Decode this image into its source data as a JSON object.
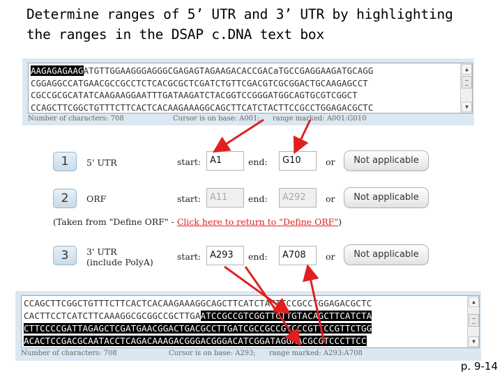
{
  "heading": {
    "line1": "Determine ranges of 5’ UTR and 3’ UTR by highlighting",
    "line2": "the ranges in the DSAP c.DNA text box"
  },
  "top_sequence_box": {
    "lines": [
      {
        "pre": "",
        "hl": "AAGAGAGAAG",
        "post": "ATGTTGGAAGGGAGGGCGAGAGTAGAAGACACCGACaTGCCGAGGAAGATGCAGG"
      },
      {
        "pre": "CGGAGGCCATGAACGCCGCCTCTCACGCGCTCGATCTGTTCGACGTCGCGGACTGCAAGAGCCT",
        "hl": "",
        "post": ""
      },
      {
        "pre": "CGCCGCGCATATCAAGAAGGAATTTGATAAGATCTACGGTCCGGGATGGCAGTGCGTCGGCT",
        "hl": "",
        "post": ""
      },
      {
        "pre": "CCAGCTTCGGCTGTTTCTTCACTCACAAGAAAGGCAGCTTCATCTACTTCCGCCTGGAGACGCTC",
        "hl": "",
        "post": ""
      }
    ],
    "status": {
      "char_count": "Number of characters: 708",
      "cursor": "Cursor is on base: A001;",
      "range": "range marked: A001:G010"
    }
  },
  "steps": [
    {
      "number": "1",
      "label": "5' UTR",
      "start_label": "start:",
      "start_value": "A1",
      "end_label": "end:",
      "end_value": "G10",
      "or_label": "or",
      "button": "Not applicable",
      "disabled": false
    },
    {
      "number": "2",
      "label": "ORF",
      "start_label": "start:",
      "start_value": "A11",
      "end_label": "end:",
      "end_value": "A292",
      "or_label": "or",
      "button": "Not applicable",
      "disabled": true
    },
    {
      "number": "3",
      "label": "3' UTR",
      "sublabel": "(include PolyA)",
      "start_label": "start:",
      "start_value": "A293",
      "end_label": "end:",
      "end_value": "A708",
      "or_label": "or",
      "button": "Not applicable",
      "disabled": false
    }
  ],
  "orf_note": {
    "prefix": "(Taken from \"Define ORF\" - ",
    "link": "Click here to return to \"Define ORF\"",
    "suffix": ")"
  },
  "bottom_sequence_box": {
    "lines": [
      {
        "pre": "CCAGCTTCGGCTGTTTCTTCACTCACAAGAAAGGCAGCTTCATCTACTTCCGCCTGGAGACGCTC",
        "hl": "",
        "post": ""
      },
      {
        "pre": "CACTTCCTCATCTTCAAAGGCGCGGCCGCTTGA",
        "hl": "ATCCGCCGTCGGTTCTTGTACAGCTTCATCTA",
        "post": ""
      },
      {
        "pre": "",
        "hl": "CTTCCCCGATTAGAGCTCGATGAACGGACTGACGCCTTGATCGCCGCCGTCCCGTTCCGTTCTGG",
        "post": ""
      },
      {
        "pre": "",
        "hl": "ACACTCCGACGCAATACCTCAGACAAAGACGGGACGGGACATCGGATAGGAACGCGTCCCTTCC",
        "post": ""
      }
    ],
    "status": {
      "char_count": "Number of characters: 708",
      "cursor": "Cursor is on base: A293;",
      "range": "range marked: A293:A708"
    }
  },
  "page_number": "p. 9-14",
  "colors": {
    "panel_bg": "#dbe7f1",
    "arrow": "#e02020",
    "link": "#d22222",
    "highlight_bg": "#000000"
  }
}
